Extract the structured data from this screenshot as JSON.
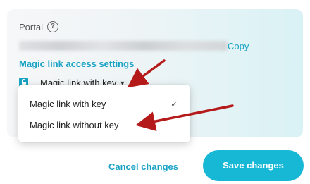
{
  "portal": {
    "label": "Portal",
    "help_icon": "help-circle-icon",
    "help_glyph": "?",
    "copy_label": "Copy"
  },
  "magic_link": {
    "title": "Magic link access settings",
    "lock_icon": "lock-icon",
    "selected_value": "Magic link with key",
    "caret": "▼",
    "options": [
      {
        "label": "Magic link with key",
        "selected": true
      },
      {
        "label": "Magic link without key",
        "selected": false
      }
    ],
    "check_glyph": "✓"
  },
  "actions": {
    "cancel_label": "Cancel changes",
    "save_label": "Save changes"
  },
  "colors": {
    "accent": "#1aa3c4",
    "save_button": "#17b7d6",
    "annotation_arrow": "#b51a1a"
  }
}
